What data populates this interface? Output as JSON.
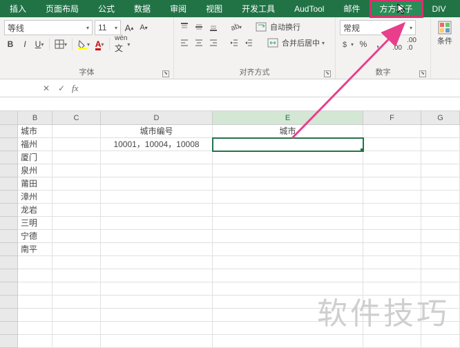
{
  "tabs": {
    "insert": "插入",
    "layout": "页面布局",
    "formula": "公式",
    "data": "数据",
    "review": "审阅",
    "view": "视图",
    "dev": "开发工具",
    "audtool": "AudTool",
    "mail": "邮件",
    "ffgg": "方方格子",
    "div": "DIV"
  },
  "ribbon": {
    "font": {
      "name": "等线",
      "size": "11",
      "group": "字体"
    },
    "align": {
      "wrap": "自动换行",
      "merge": "合并后居中",
      "group": "对齐方式"
    },
    "number": {
      "format": "常规",
      "group": "数字"
    },
    "cond": "条件"
  },
  "cols": {
    "B": "B",
    "C": "C",
    "D": "D",
    "E": "E",
    "F": "F",
    "G": "G"
  },
  "cells": {
    "B": [
      "城市",
      "福州",
      "厦门",
      "泉州",
      "莆田",
      "漳州",
      "龙岩",
      "三明",
      "宁德",
      "南平"
    ],
    "D_head": "城市编号",
    "D2": "10001，10004，10008",
    "E_head": "城市"
  },
  "watermark": "软件技巧"
}
